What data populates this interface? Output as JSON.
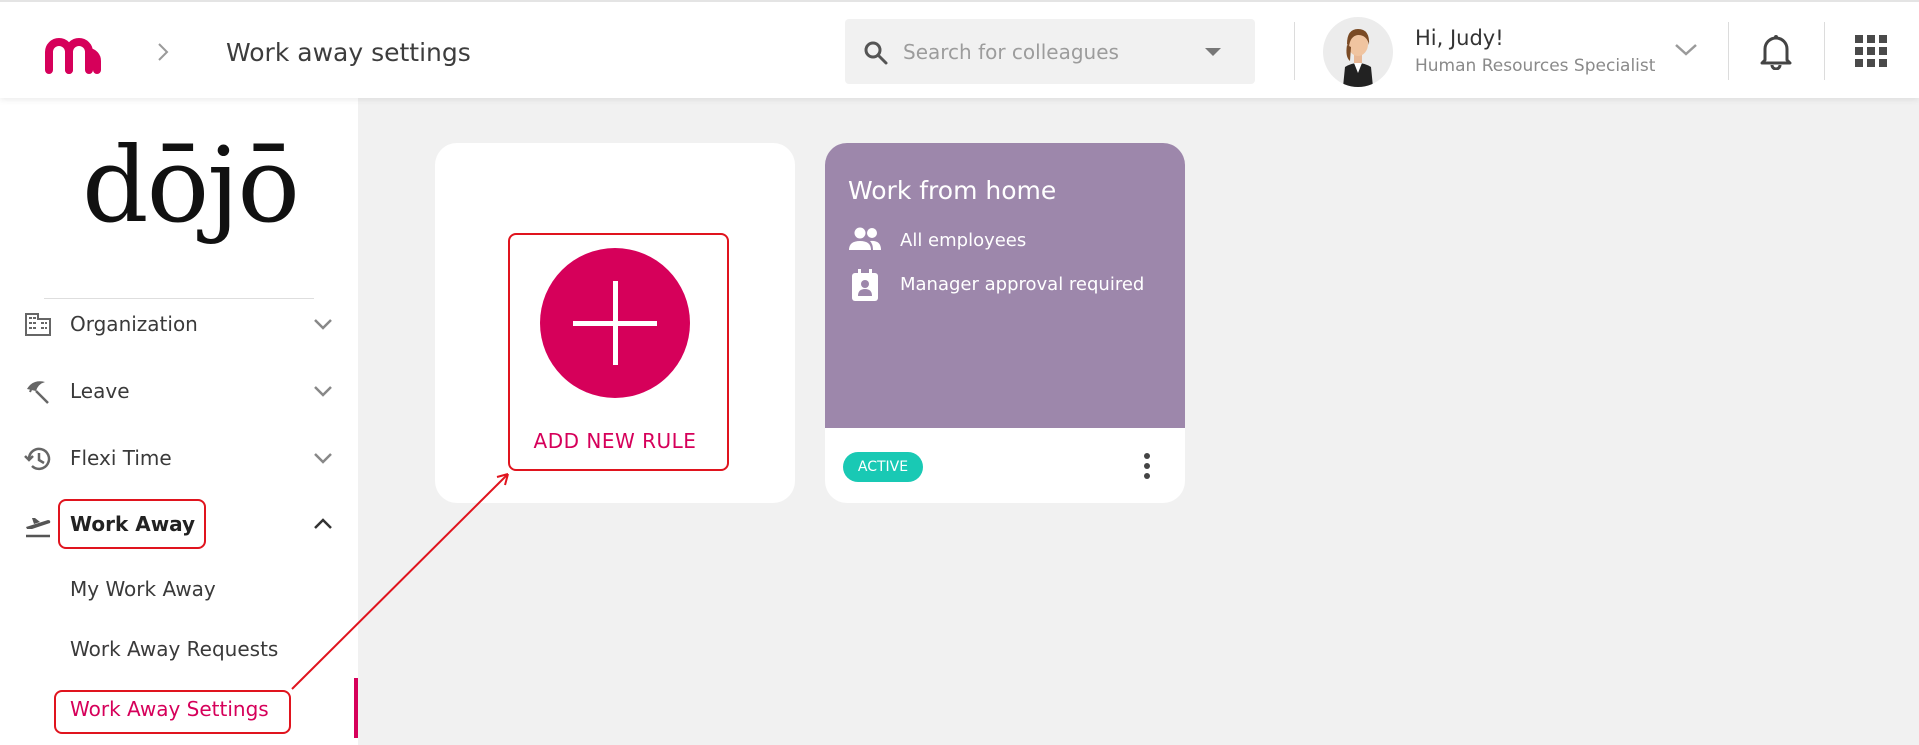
{
  "header": {
    "page_title": "Work away settings",
    "search_placeholder": "Search for colleagues",
    "greeting": "Hi, Judy!",
    "role": "Human Resources Specialist"
  },
  "sidebar": {
    "brand": "dōjō",
    "items": [
      {
        "label": "Organization",
        "icon": "building-icon",
        "expanded": false
      },
      {
        "label": "Leave",
        "icon": "beach-umbrella-icon",
        "expanded": false
      },
      {
        "label": "Flexi Time",
        "icon": "history-icon",
        "expanded": false
      },
      {
        "label": "Work Away",
        "icon": "airplane-takeoff-icon",
        "expanded": true
      }
    ],
    "subitems": [
      {
        "label": "My Work Away",
        "active": false
      },
      {
        "label": "Work Away Requests",
        "active": false
      },
      {
        "label": "Work Away Settings",
        "active": true
      }
    ]
  },
  "add_rule": {
    "label": "ADD NEW RULE"
  },
  "rules": [
    {
      "title": "Work from home",
      "audience": "All employees",
      "approval": "Manager approval required",
      "status": "ACTIVE"
    }
  ],
  "colors": {
    "accent": "#d6005a",
    "rule_card": "#9d87ab",
    "active_badge": "#19c9b4",
    "annotation": "#e0141e"
  }
}
